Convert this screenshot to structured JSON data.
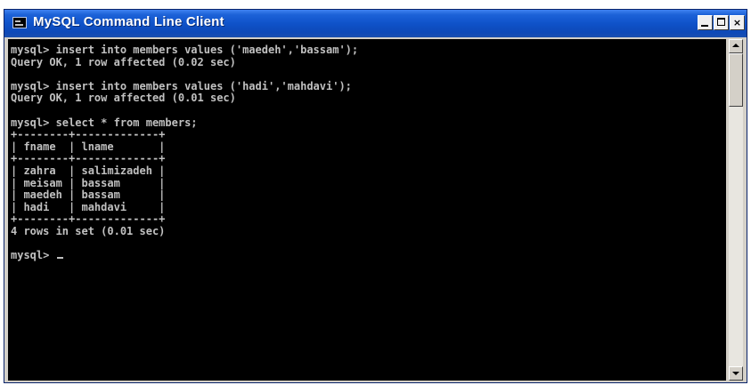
{
  "window": {
    "title": "MySQL Command Line Client"
  },
  "icons": {
    "app": "console-app-icon",
    "minimize": "minimize-icon",
    "maximize": "maximize-icon",
    "close": "close-icon"
  },
  "titlebar_buttons": {
    "close_label": "×"
  },
  "colors": {
    "titlebar": "#0f52c9",
    "console_background": "#000000",
    "console_text": "#c0c0c0"
  },
  "console": {
    "lines": [
      "mysql> insert into members values ('maedeh','bassam');",
      "Query OK, 1 row affected (0.02 sec)",
      "",
      "mysql> insert into members values ('hadi','mahdavi');",
      "Query OK, 1 row affected (0.01 sec)",
      "",
      "mysql> select * from members;",
      "+--------+-------------+",
      "| fname  | lname       |",
      "+--------+-------------+",
      "| zahra  | salimizadeh |",
      "| meisam | bassam      |",
      "| maedeh | bassam      |",
      "| hadi   | mahdavi     |",
      "+--------+-------------+",
      "4 rows in set (0.01 sec)",
      ""
    ],
    "prompt": "mysql> "
  }
}
